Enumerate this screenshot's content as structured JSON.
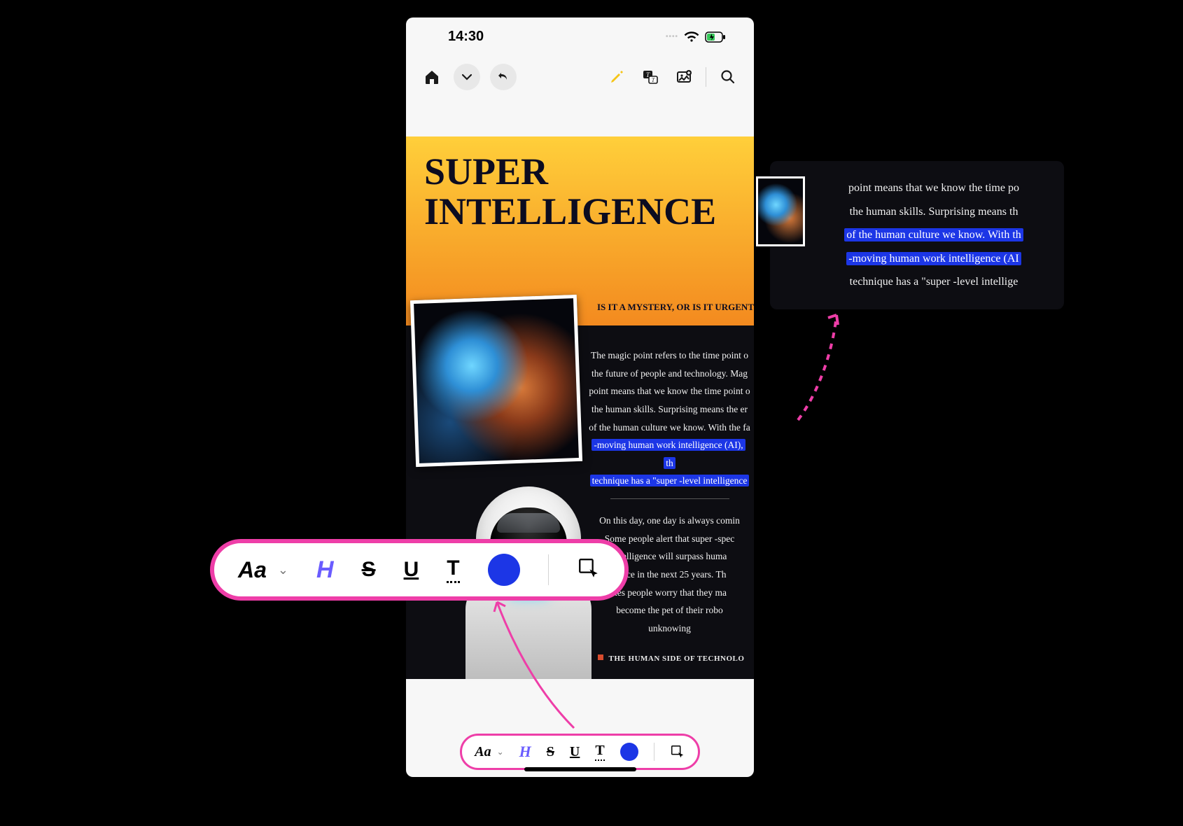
{
  "status": {
    "time": "14:30"
  },
  "toolbar": {
    "home": "home",
    "expand": "chevron-down",
    "undo": "undo",
    "highlighter": "highlighter",
    "text_image": "text-image",
    "image_add": "image-add",
    "search": "search"
  },
  "article": {
    "title_l1": "SUPER",
    "title_l2": "INTELLIGENCE",
    "subhead": "IS IT A MYSTERY, OR IS IT URGENT",
    "p1a": "The magic point refers to the time point o",
    "p1b": "the future of people and technology. Mag",
    "p1c": "point means that we know the time point o",
    "p1d": "the human skills. Surprising means the er",
    "p1e": "of the human culture we know. With the fa",
    "hl1": "-moving human work intelligence (AI), th",
    "hl2": "technique has a \"super -level intelligence",
    "p2a": "On this day, one day is always comin",
    "p2b": "Some people alert that super -spec",
    "p2c": "intelligence will surpass huma",
    "p2d": "gence in the next 25 years. Th",
    "p2e": "kes people worry that they ma",
    "p2f": "become the pet of their robo",
    "p2g": "unknowing",
    "footer": "THE HUMAN SIDE OF TECHNOLO"
  },
  "popout": {
    "l1": "point means that we know the time po",
    "l2": "the human skills. Surprising means th",
    "h1": "of the human culture we know. With th",
    "h2": "-moving human work intelligence (AI",
    "l3": "technique has a \"super -level intellige"
  },
  "fmt": {
    "font": "Aa",
    "highlight": "H",
    "strike": "S",
    "underline": "U",
    "squiggle": "T",
    "color": "#1c36e6"
  }
}
